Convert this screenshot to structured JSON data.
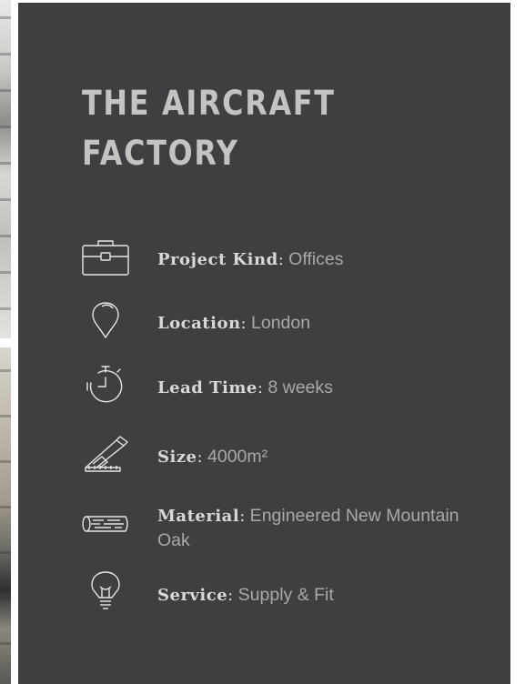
{
  "project": {
    "title_line1": "THE AIRCRAFT",
    "title_line2": "FACTORY"
  },
  "specs": [
    {
      "label": "Project Kind",
      "separator": ":",
      "value": " Offices",
      "icon": "briefcase-icon"
    },
    {
      "label": "Location",
      "separator": ":",
      "value": " London",
      "icon": "location-pin-icon"
    },
    {
      "label": "Lead Time",
      "separator": ":",
      "value": " 8 weeks",
      "icon": "stopwatch-icon"
    },
    {
      "label": "Size",
      "separator": ":",
      "value": " 4000m²",
      "icon": "ruler-pencil-icon"
    },
    {
      "label": "Material",
      "separator": ":",
      "value": " Engineered New Mountain Oak",
      "icon": "timber-log-icon"
    },
    {
      "label": "Service",
      "separator": ":",
      "value": " Supply & Fit",
      "icon": "lightbulb-icon"
    }
  ],
  "colors": {
    "panel_background": "#3f3e40",
    "title": "#c3c3c1",
    "label": "#d8d8d6",
    "value": "#a9a9a8",
    "icon_stroke": "#e6e6e4"
  }
}
